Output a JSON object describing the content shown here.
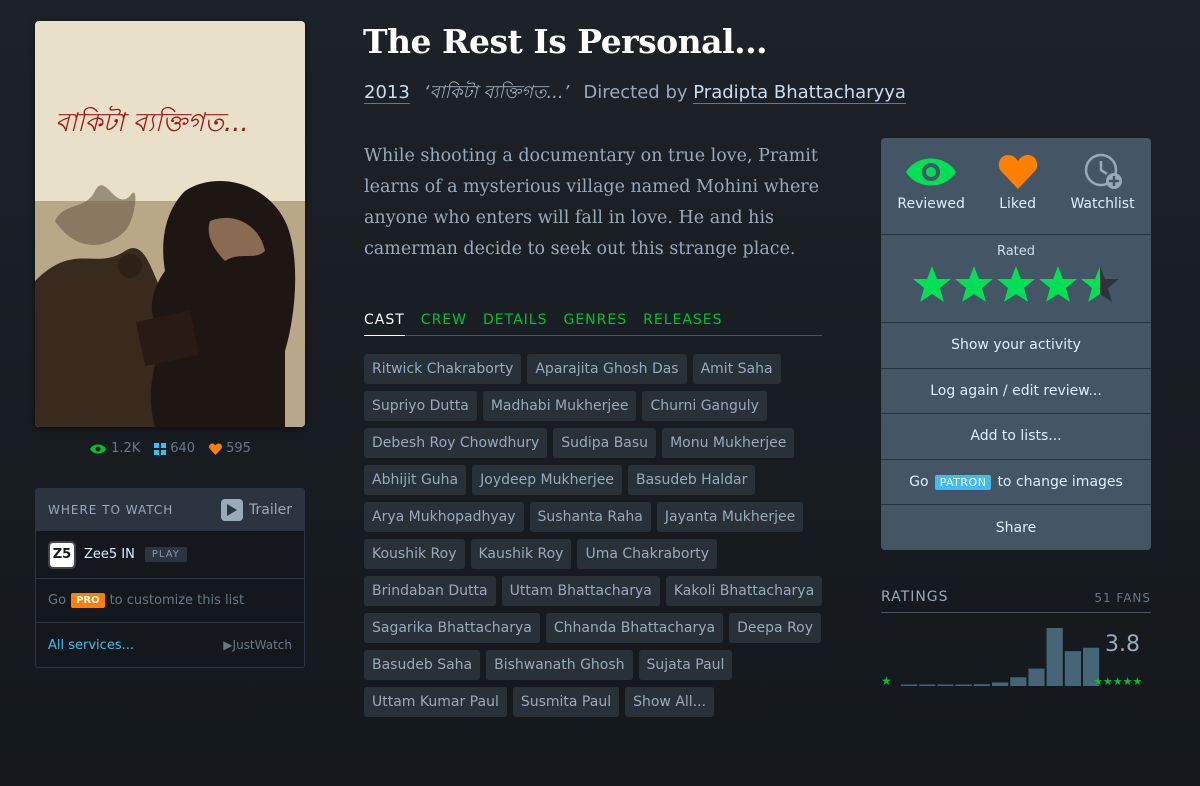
{
  "film": {
    "title": "The Rest Is Personal...",
    "year": "2013",
    "original_title": "‘বাকিটা ব্যক্তিগত...’",
    "directed_by_label": "Directed by",
    "director": "Pradipta Bhattacharyya",
    "synopsis": "While shooting a documentary on true love, Pramit learns of a mysterious village named Mohini where anyone who enters will fall in love. He and his camerman decide to seek out this strange place."
  },
  "poster": {
    "title_art": "বাকিটা ব্যক্তিগত..."
  },
  "stats": {
    "watched": "1.2K",
    "lists": "640",
    "likes": "595"
  },
  "where_to_watch": {
    "heading": "WHERE TO WATCH",
    "trailer_label": "Trailer",
    "service_logo": "Z5",
    "service_name": "Zee5 IN",
    "service_tag": "PLAY",
    "pro_prefix": "Go",
    "pro_tag": "PRO",
    "pro_suffix": "to customize this list",
    "all_services": "All services...",
    "justwatch": "JustWatch"
  },
  "tabs": [
    "CAST",
    "CREW",
    "DETAILS",
    "GENRES",
    "RELEASES"
  ],
  "cast": [
    "Ritwick Chakraborty",
    "Aparajita Ghosh Das",
    "Amit Saha",
    "Supriyo Dutta",
    "Madhabi Mukherjee",
    "Churni Ganguly",
    "Debesh Roy Chowdhury",
    "Sudipa Basu",
    "Monu Mukherjee",
    "Abhijit Guha",
    "Joydeep Mukherjee",
    "Basudeb Haldar",
    "Arya Mukhopadhyay",
    "Sushanta Raha",
    "Jayanta Mukherjee",
    "Koushik Roy",
    "Kaushik Roy",
    "Uma Chakraborty",
    "Brindaban Dutta",
    "Uttam Bhattacharya",
    "Kakoli Bhattacharya",
    "Sagarika Bhattacharya",
    "Chhanda Bhattacharya",
    "Deepa Roy",
    "Basudeb Saha",
    "Bishwanath Ghosh",
    "Sujata Paul",
    "Uttam Kumar Paul",
    "Susmita Paul",
    "Show All..."
  ],
  "actions": {
    "reviewed": "Reviewed",
    "liked": "Liked",
    "watchlist": "Watchlist",
    "rated_label": "Rated",
    "rating": 4.5,
    "show_activity": "Show your activity",
    "log_again": "Log again / edit review...",
    "add_to_lists": "Add to lists...",
    "change_images_prefix": "Go",
    "patron_tag": "PATRON",
    "change_images_suffix": "to change images",
    "share": "Share"
  },
  "ratings": {
    "heading": "RATINGS",
    "fans": "51 FANS",
    "average": "3.8",
    "min_star": "★",
    "max_stars": "★★★★★",
    "distribution": [
      0.02,
      0.02,
      0.02,
      0.02,
      0.03,
      0.06,
      0.15,
      0.3,
      1.0,
      0.6,
      0.66
    ]
  },
  "colors": {
    "green": "#00e054",
    "orange": "#ff8000",
    "blue": "#40bcf4",
    "panel": "#445566"
  }
}
